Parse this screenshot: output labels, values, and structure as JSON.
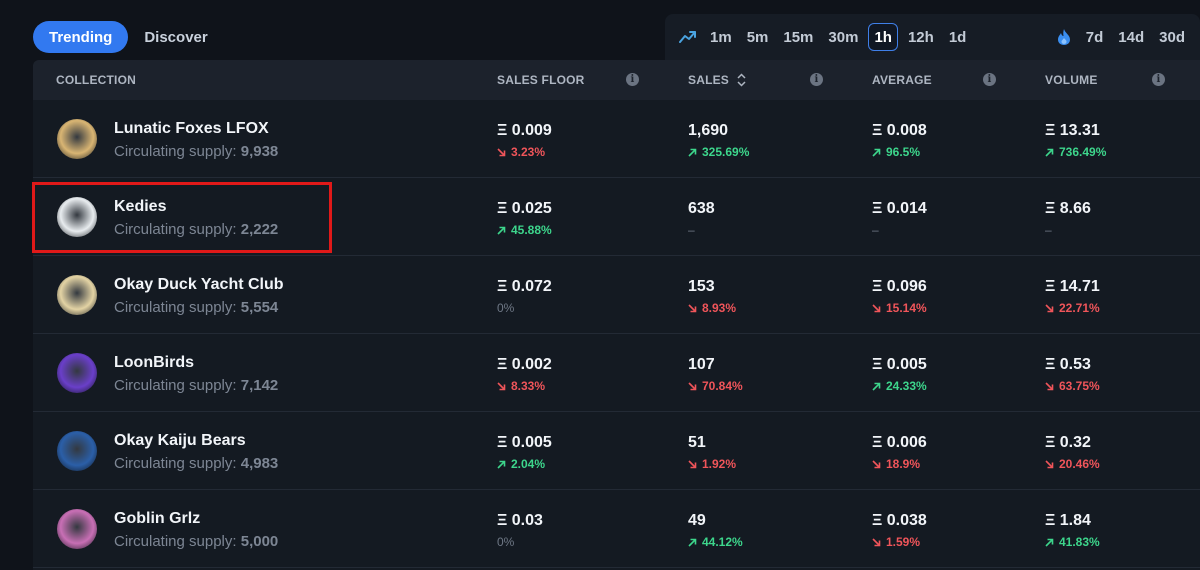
{
  "tabs": [
    {
      "label": "Trending",
      "active": true
    },
    {
      "label": "Discover",
      "active": false
    }
  ],
  "time_ranges": {
    "icon": "trending-up-icon",
    "short": [
      {
        "label": "1m"
      },
      {
        "label": "5m"
      },
      {
        "label": "15m"
      },
      {
        "label": "30m"
      },
      {
        "label": "1h",
        "active": true
      },
      {
        "label": "12h"
      },
      {
        "label": "1d"
      }
    ],
    "long_icon": "flame-icon",
    "long": [
      {
        "label": "7d"
      },
      {
        "label": "14d"
      },
      {
        "label": "30d"
      }
    ]
  },
  "table": {
    "headers": {
      "collection": "COLLECTION",
      "sales_floor": "SALES FLOOR",
      "sales": "SALES",
      "average": "AVERAGE",
      "volume": "VOLUME"
    },
    "supply_label": "Circulating supply:",
    "rows": [
      {
        "name": "Lunatic Foxes LFOX",
        "supply": "9,938",
        "avatar_color": "#d9b573",
        "floor": "Ξ 0.009",
        "floor_chg": "3.23%",
        "floor_dir": "down",
        "sales": "1,690",
        "sales_chg": "325.69%",
        "sales_dir": "up",
        "avg": "Ξ 0.008",
        "avg_chg": "96.5%",
        "avg_dir": "up",
        "vol": "Ξ 13.31",
        "vol_chg": "736.49%",
        "vol_dir": "up"
      },
      {
        "name": "Kedies",
        "supply": "2,222",
        "avatar_color": "#e8ecef",
        "floor": "Ξ 0.025",
        "floor_chg": "45.88%",
        "floor_dir": "up",
        "sales": "638",
        "sales_chg": "–",
        "sales_dir": "flat",
        "avg": "Ξ 0.014",
        "avg_chg": "–",
        "avg_dir": "flat",
        "vol": "Ξ 8.66",
        "vol_chg": "–",
        "vol_dir": "flat"
      },
      {
        "name": "Okay Duck Yacht Club",
        "supply": "5,554",
        "avatar_color": "#e3d3a4",
        "floor": "Ξ 0.072",
        "floor_chg": "0%",
        "floor_dir": "flat",
        "sales": "153",
        "sales_chg": "8.93%",
        "sales_dir": "down",
        "avg": "Ξ 0.096",
        "avg_chg": "15.14%",
        "avg_dir": "down",
        "vol": "Ξ 14.71",
        "vol_chg": "22.71%",
        "vol_dir": "down"
      },
      {
        "name": "LoonBirds",
        "supply": "7,142",
        "avatar_color": "#6a3fc9",
        "floor": "Ξ 0.002",
        "floor_chg": "8.33%",
        "floor_dir": "down",
        "sales": "107",
        "sales_chg": "70.84%",
        "sales_dir": "down",
        "avg": "Ξ 0.005",
        "avg_chg": "24.33%",
        "avg_dir": "up",
        "vol": "Ξ 0.53",
        "vol_chg": "63.75%",
        "vol_dir": "down"
      },
      {
        "name": "Okay Kaiju Bears",
        "supply": "4,983",
        "avatar_color": "#2b5fa8",
        "floor": "Ξ 0.005",
        "floor_chg": "2.04%",
        "floor_dir": "up",
        "sales": "51",
        "sales_chg": "1.92%",
        "sales_dir": "down",
        "avg": "Ξ 0.006",
        "avg_chg": "18.9%",
        "avg_dir": "down",
        "vol": "Ξ 0.32",
        "vol_chg": "20.46%",
        "vol_dir": "down"
      },
      {
        "name": "Goblin Grlz",
        "supply": "5,000",
        "avatar_color": "#c86fb5",
        "floor": "Ξ 0.03",
        "floor_chg": "0%",
        "floor_dir": "flat",
        "sales": "49",
        "sales_chg": "44.12%",
        "sales_dir": "up",
        "avg": "Ξ 0.038",
        "avg_chg": "1.59%",
        "avg_dir": "down",
        "vol": "Ξ 1.84",
        "vol_chg": "41.83%",
        "vol_dir": "up"
      }
    ]
  },
  "colors": {
    "accent": "#3279f0",
    "up": "#3dd68c",
    "down": "#f0555a",
    "highlight": "#e01919"
  }
}
